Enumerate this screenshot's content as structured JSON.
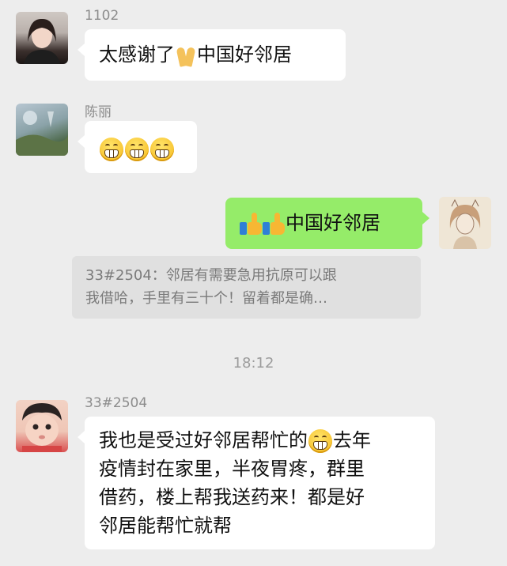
{
  "messages": [
    {
      "sender": "1102",
      "text_prefix": "太感谢了",
      "emoji": "folded-hands-icon",
      "text_suffix": "中国好邻居"
    },
    {
      "sender": "陈丽",
      "emoji": "grinning-face-icon",
      "emoji_count": 3
    },
    {
      "sender": "self",
      "emoji": "thumbs-up-icon",
      "emoji_count": 2,
      "text": "中国好邻居"
    },
    {
      "quote": {
        "line1": "33#2504：邻居有需要急用抗原可以跟",
        "line2": "我借哈，手里有三十个！留着都是确…"
      }
    },
    {
      "timestamp": "18:12"
    },
    {
      "sender": "33#2504",
      "line1_prefix": "我也是受过好邻居帮忙的",
      "line1_emoji": "grinning-face-icon",
      "line1_suffix": "去年",
      "line2": "疫情封在家里，半夜胃疼，群里",
      "line3": "借药，楼上帮我送药来！都是好",
      "line4": "邻居能帮忙就帮"
    }
  ],
  "colors": {
    "background": "#ededed",
    "bubble_self": "#95ec69",
    "bubble_other": "#ffffff"
  }
}
